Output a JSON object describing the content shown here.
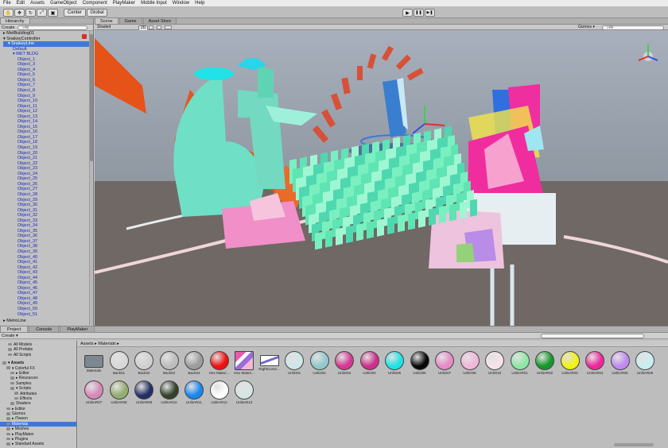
{
  "menu": [
    "File",
    "Edit",
    "Assets",
    "GameObject",
    "Component",
    "PlayMaker",
    "Mobile Input",
    "Window",
    "Help"
  ],
  "toolbar": {
    "pivot": "Center",
    "space": "Global",
    "play": "▶",
    "pause": "❚❚",
    "step": "▶❚"
  },
  "hierarchy": {
    "tab": "Hierarchy",
    "create": "Create",
    "search_placeholder": "⌕All",
    "rows": [
      {
        "text": "▸ MetBuilding01",
        "indent": 0,
        "style": "normal"
      },
      {
        "text": "▾ SnakeyController",
        "indent": 0,
        "style": "normal"
      },
      {
        "text": "▾ SnakeyLine",
        "indent": 1,
        "style": "sel"
      },
      {
        "text": "Default",
        "indent": 2,
        "style": "blue"
      },
      {
        "text": "▾ MET BLDG",
        "indent": 2,
        "style": "blue"
      },
      {
        "text": "Object_1",
        "indent": 3,
        "style": "blue"
      },
      {
        "text": "Object_3",
        "indent": 3,
        "style": "blue"
      },
      {
        "text": "Object_4",
        "indent": 3,
        "style": "blue"
      },
      {
        "text": "Object_5",
        "indent": 3,
        "style": "blue"
      },
      {
        "text": "Object_6",
        "indent": 3,
        "style": "blue"
      },
      {
        "text": "Object_7",
        "indent": 3,
        "style": "blue"
      },
      {
        "text": "Object_8",
        "indent": 3,
        "style": "blue"
      },
      {
        "text": "Object_9",
        "indent": 3,
        "style": "blue"
      },
      {
        "text": "Object_10",
        "indent": 3,
        "style": "blue"
      },
      {
        "text": "Object_11",
        "indent": 3,
        "style": "blue"
      },
      {
        "text": "Object_12",
        "indent": 3,
        "style": "blue"
      },
      {
        "text": "Object_13",
        "indent": 3,
        "style": "blue"
      },
      {
        "text": "Object_14",
        "indent": 3,
        "style": "blue"
      },
      {
        "text": "Object_15",
        "indent": 3,
        "style": "blue"
      },
      {
        "text": "Object_16",
        "indent": 3,
        "style": "blue"
      },
      {
        "text": "Object_17",
        "indent": 3,
        "style": "blue"
      },
      {
        "text": "Object_18",
        "indent": 3,
        "style": "blue"
      },
      {
        "text": "Object_19",
        "indent": 3,
        "style": "blue"
      },
      {
        "text": "Object_20",
        "indent": 3,
        "style": "blue"
      },
      {
        "text": "Object_21",
        "indent": 3,
        "style": "blue"
      },
      {
        "text": "Object_22",
        "indent": 3,
        "style": "blue"
      },
      {
        "text": "Object_23",
        "indent": 3,
        "style": "blue"
      },
      {
        "text": "Object_24",
        "indent": 3,
        "style": "blue"
      },
      {
        "text": "Object_25",
        "indent": 3,
        "style": "blue"
      },
      {
        "text": "Object_26",
        "indent": 3,
        "style": "blue"
      },
      {
        "text": "Object_27",
        "indent": 3,
        "style": "blue"
      },
      {
        "text": "Object_28",
        "indent": 3,
        "style": "blue"
      },
      {
        "text": "Object_29",
        "indent": 3,
        "style": "blue"
      },
      {
        "text": "Object_30",
        "indent": 3,
        "style": "blue"
      },
      {
        "text": "Object_31",
        "indent": 3,
        "style": "blue"
      },
      {
        "text": "Object_32",
        "indent": 3,
        "style": "blue"
      },
      {
        "text": "Object_33",
        "indent": 3,
        "style": "blue"
      },
      {
        "text": "Object_34",
        "indent": 3,
        "style": "blue"
      },
      {
        "text": "Object_35",
        "indent": 3,
        "style": "blue"
      },
      {
        "text": "Object_36",
        "indent": 3,
        "style": "blue"
      },
      {
        "text": "Object_37",
        "indent": 3,
        "style": "blue"
      },
      {
        "text": "Object_38",
        "indent": 3,
        "style": "blue"
      },
      {
        "text": "Object_39",
        "indent": 3,
        "style": "blue"
      },
      {
        "text": "Object_40",
        "indent": 3,
        "style": "blue"
      },
      {
        "text": "Object_41",
        "indent": 3,
        "style": "blue"
      },
      {
        "text": "Object_42",
        "indent": 3,
        "style": "blue"
      },
      {
        "text": "Object_43",
        "indent": 3,
        "style": "blue"
      },
      {
        "text": "Object_44",
        "indent": 3,
        "style": "blue"
      },
      {
        "text": "Object_45",
        "indent": 3,
        "style": "blue"
      },
      {
        "text": "Object_46",
        "indent": 3,
        "style": "blue"
      },
      {
        "text": "Object_47",
        "indent": 3,
        "style": "blue"
      },
      {
        "text": "Object_48",
        "indent": 3,
        "style": "blue"
      },
      {
        "text": "Object_49",
        "indent": 3,
        "style": "blue"
      },
      {
        "text": "Object_50",
        "indent": 3,
        "style": "blue"
      },
      {
        "text": "Object_51",
        "indent": 3,
        "style": "blue"
      }
    ],
    "footer": "▸ MetroLine"
  },
  "scene": {
    "tabs": [
      "Scene",
      "Game",
      "Asset Store"
    ],
    "render_mode": "Shaded",
    "mode_2d": "2D",
    "gizmos": "Gizmos ▾",
    "search_placeholder": "⌕All"
  },
  "project": {
    "tabs": [
      "Project",
      "Console",
      "PlayMaker"
    ],
    "create": "Create ▾",
    "breadcrumb": "Assets ▸ Materials ▸",
    "favorites": [
      "All Models",
      "All Prefabs",
      "All Scripts"
    ],
    "folders": [
      {
        "text": "▾ Assets",
        "indent": 0,
        "style": "bold"
      },
      {
        "text": "▾ Colorful FX",
        "indent": 1,
        "style": "normal"
      },
      {
        "text": "▸ Editor",
        "indent": 2,
        "style": "normal"
      },
      {
        "text": "▸ Resources",
        "indent": 2,
        "style": "normal"
      },
      {
        "text": "Samples",
        "indent": 2,
        "style": "normal"
      },
      {
        "text": "▾ Scripts",
        "indent": 2,
        "style": "normal"
      },
      {
        "text": "Attributes",
        "indent": 3,
        "style": "normal"
      },
      {
        "text": "Effects",
        "indent": 3,
        "style": "normal"
      },
      {
        "text": "Shaders",
        "indent": 2,
        "style": "normal"
      },
      {
        "text": "▸ Editor",
        "indent": 1,
        "style": "normal"
      },
      {
        "text": "Gizmos",
        "indent": 1,
        "style": "normal"
      },
      {
        "text": "▸ iTween",
        "indent": 1,
        "style": "normal"
      },
      {
        "text": "Materials",
        "indent": 1,
        "style": "sel"
      },
      {
        "text": "▸ Meshes",
        "indent": 1,
        "style": "normal"
      },
      {
        "text": "▸ PlayMaker",
        "indent": 1,
        "style": "normal"
      },
      {
        "text": "▸ Plugins",
        "indent": 1,
        "style": "normal"
      },
      {
        "text": "▸ Standard Assets",
        "indent": 1,
        "style": "normal"
      }
    ],
    "assets": [
      {
        "name": "Materials",
        "color": "#7d8790",
        "kind": "folder"
      },
      {
        "name": "Back01",
        "color": "#d8d8d8",
        "kind": "sphere"
      },
      {
        "name": "Back02",
        "color": "#d0d0d0",
        "kind": "sphere"
      },
      {
        "name": "Back03",
        "color": "#bcbcbc",
        "kind": "sphere"
      },
      {
        "name": "Back04",
        "color": "#9c9c9c",
        "kind": "sphere"
      },
      {
        "name": "Hex Materi...",
        "color": "#ef1010",
        "kind": "sphere"
      },
      {
        "name": "Hex Materi...",
        "color": "#e07ab6",
        "kind": "tex"
      },
      {
        "name": "RightCurve...",
        "color": "#ffffff",
        "kind": "curve"
      },
      {
        "name": "UnliO01",
        "color": "#cfe7ea",
        "kind": "sphere"
      },
      {
        "name": "UnliO02",
        "color": "#92c9cd",
        "kind": "sphere"
      },
      {
        "name": "UnliO03",
        "color": "#d23a93",
        "kind": "sphere"
      },
      {
        "name": "UnliO04",
        "color": "#ce2e8d",
        "kind": "sphere"
      },
      {
        "name": "UnliO05",
        "color": "#1de3e6",
        "kind": "sphere"
      },
      {
        "name": "UnliO06",
        "color": "#060606",
        "kind": "sphere"
      },
      {
        "name": "UnliO07",
        "color": "#e58bc6",
        "kind": "sphere"
      },
      {
        "name": "UnliO08",
        "color": "#f2b7d8",
        "kind": "sphere"
      },
      {
        "name": "UnliO10",
        "color": "#f8e2ea",
        "kind": "sphere"
      },
      {
        "name": "UnlitAR01",
        "color": "#8ee8a5",
        "kind": "sphere"
      },
      {
        "name": "UnlitAR02",
        "color": "#15982c",
        "kind": "sphere"
      },
      {
        "name": "UnlitAR03",
        "color": "#f2f213",
        "kind": "sphere"
      },
      {
        "name": "UnlitAR04",
        "color": "#f0269b",
        "kind": "sphere"
      },
      {
        "name": "UnlitAR05",
        "color": "#c08bf0",
        "kind": "sphere"
      },
      {
        "name": "UnlitAR06",
        "color": "#c9eef2",
        "kind": "sphere"
      },
      {
        "name": "UnlitAR07",
        "color": "#d989b7",
        "kind": "sphere"
      },
      {
        "name": "UnlitAR08",
        "color": "#93ad6e",
        "kind": "sphere"
      },
      {
        "name": "UnlitAR09",
        "color": "#233066",
        "kind": "sphere"
      },
      {
        "name": "UnlitAR10",
        "color": "#34402c",
        "kind": "sphere"
      },
      {
        "name": "UnlitAR11",
        "color": "#1a86ef",
        "kind": "sphere"
      },
      {
        "name": "UnlitAR12",
        "color": "#fdfdfd",
        "kind": "sphere"
      },
      {
        "name": "UnlitAR13",
        "color": "#d6e6e2",
        "kind": "sphere"
      }
    ]
  },
  "colors": {
    "sky": "#9da7b3",
    "ground": "#6f6864",
    "selection": "#3d78d8"
  }
}
